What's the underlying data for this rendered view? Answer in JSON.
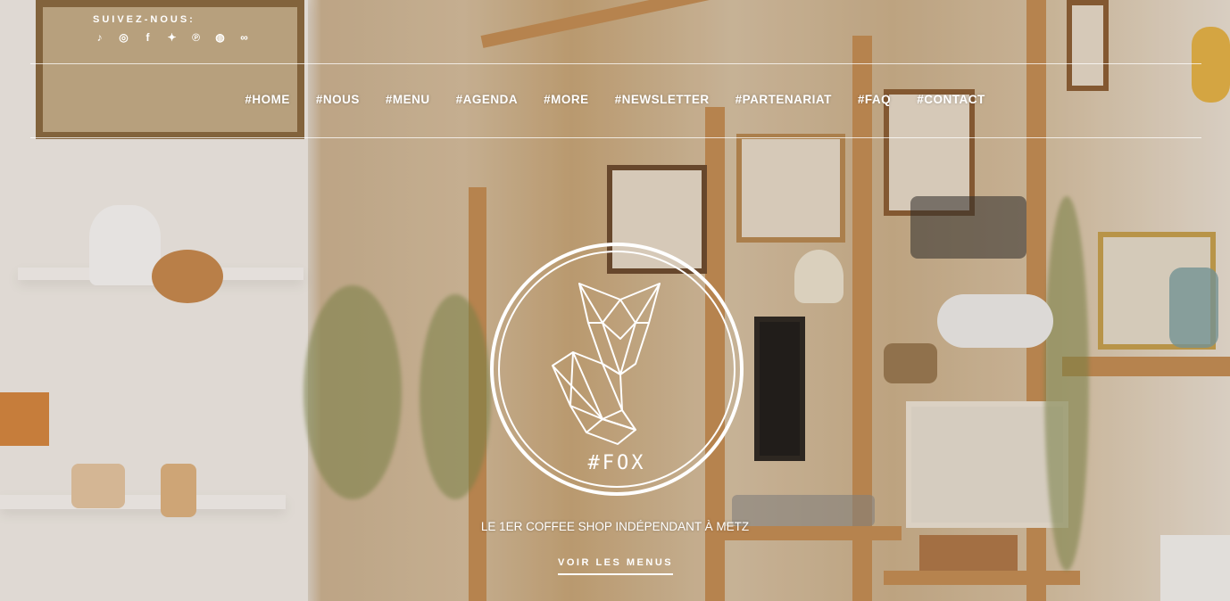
{
  "social": {
    "label": "SUIVEZ-NOUS:",
    "icons": [
      "tiktok-icon",
      "instagram-icon",
      "facebook-icon",
      "twitter-icon",
      "pinterest-icon",
      "snapchat-icon",
      "tripadvisor-icon"
    ]
  },
  "nav": {
    "items": [
      "#HOME",
      "#NOUS",
      "#MENU",
      "#AGENDA",
      "#MORE",
      "#NEWSLETTER",
      "#PARTENARIAT",
      "#FAQ",
      "#CONTACT"
    ]
  },
  "logo": {
    "text": "#FOX"
  },
  "hero": {
    "tagline": "LE 1ER COFFEE SHOP INDÉPENDANT À METZ",
    "cta": "VOIR LES MENUS"
  }
}
